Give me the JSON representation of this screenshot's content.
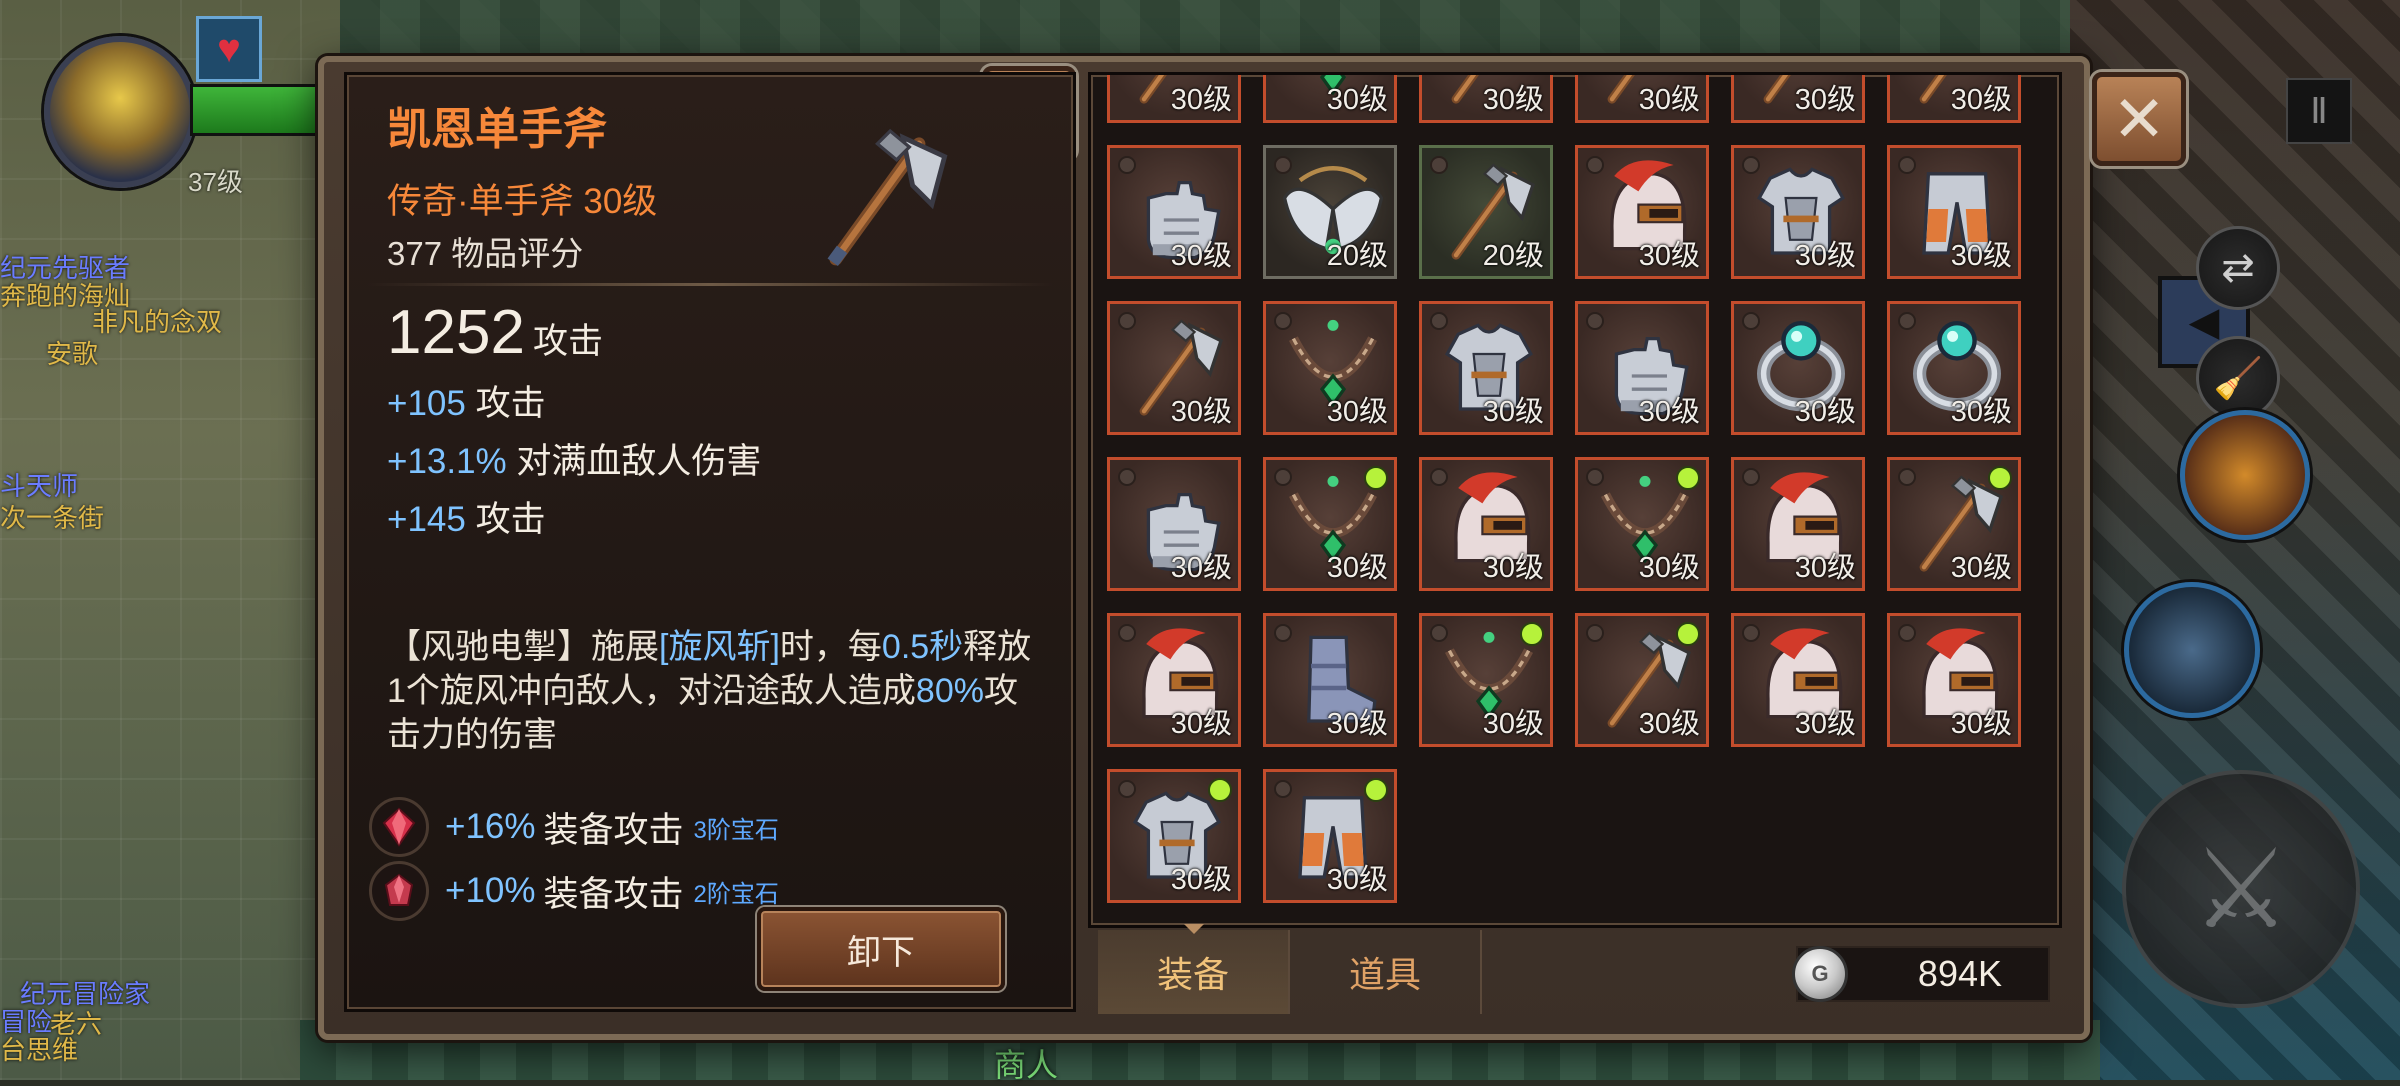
{
  "hud": {
    "level": "37级",
    "chat_names": [
      {
        "text": "纪元先驱者",
        "color": "#6a7cff"
      },
      {
        "text": "奔跑的海灿",
        "color": "#e0b848"
      },
      {
        "text": "非凡的念双",
        "color": "#e0b848"
      },
      {
        "text": "安歌",
        "color": "#e0b848"
      },
      {
        "text": "斗天师",
        "color": "#6a7cff"
      },
      {
        "text": "次一条街",
        "color": "#e0b848"
      },
      {
        "text": "纪元冒险家",
        "color": "#6a7cff"
      },
      {
        "text": "老六",
        "color": "#e0b848"
      },
      {
        "text": "冒险",
        "color": "#6a7cff"
      },
      {
        "text": "台思维",
        "color": "#e0b848"
      }
    ],
    "npc_label": "商人",
    "pause_icon": "Ⅱ",
    "collapse_icon": "◀"
  },
  "item_detail": {
    "name": "凯恩单手斧",
    "subtitle": "传奇·单手斧 30级",
    "score": "377 物品评分",
    "main_attack_value": "1252",
    "main_attack_label": "攻击",
    "stats": [
      {
        "value": "+105",
        "label": "攻击"
      },
      {
        "value": "+13.1%",
        "label": "对满血敌人伤害"
      },
      {
        "value": "+145",
        "label": "攻击"
      }
    ],
    "skill": {
      "part1": "【风驰电掣】施展",
      "skill_name": "[旋风斩]",
      "part2": "时，每",
      "interval": "0.5秒",
      "part3": "释放1个旋风冲向敌人，对沿途敌人造成",
      "percent": "80%",
      "part4": "攻击力的伤害"
    },
    "gems": [
      {
        "value": "+16%",
        "label": "装备攻击",
        "tier": "3阶宝石"
      },
      {
        "value": "+10%",
        "label": "装备攻击",
        "tier": "2阶宝石"
      }
    ],
    "unequip_label": "卸下"
  },
  "inventory": {
    "items": [
      {
        "type": "axe",
        "level": "30级",
        "rarity": "epic",
        "new": false
      },
      {
        "type": "necklace",
        "level": "30级",
        "rarity": "epic",
        "new": false
      },
      {
        "type": "axe",
        "level": "30级",
        "rarity": "epic",
        "new": false
      },
      {
        "type": "axe",
        "level": "30级",
        "rarity": "epic",
        "new": false
      },
      {
        "type": "axe",
        "level": "30级",
        "rarity": "epic",
        "new": false
      },
      {
        "type": "axe",
        "level": "30级",
        "rarity": "epic",
        "new": false
      },
      {
        "type": "gauntlet",
        "level": "30级",
        "rarity": "epic",
        "new": false
      },
      {
        "type": "wings",
        "level": "20级",
        "rarity": "rare",
        "new": false
      },
      {
        "type": "axe",
        "level": "20级",
        "rarity": "uncommon",
        "new": false
      },
      {
        "type": "helmet",
        "level": "30级",
        "rarity": "epic",
        "new": false
      },
      {
        "type": "armor",
        "level": "30级",
        "rarity": "epic",
        "new": false
      },
      {
        "type": "pants",
        "level": "30级",
        "rarity": "epic",
        "new": false
      },
      {
        "type": "axe",
        "level": "30级",
        "rarity": "epic",
        "new": false
      },
      {
        "type": "necklace",
        "level": "30级",
        "rarity": "epic",
        "new": false
      },
      {
        "type": "armor",
        "level": "30级",
        "rarity": "epic",
        "new": false
      },
      {
        "type": "gauntlet",
        "level": "30级",
        "rarity": "epic",
        "new": false
      },
      {
        "type": "ring",
        "level": "30级",
        "rarity": "epic",
        "new": false
      },
      {
        "type": "ring",
        "level": "30级",
        "rarity": "epic",
        "new": false
      },
      {
        "type": "gauntlet",
        "level": "30级",
        "rarity": "epic",
        "new": false
      },
      {
        "type": "necklace",
        "level": "30级",
        "rarity": "epic",
        "new": true
      },
      {
        "type": "helmet",
        "level": "30级",
        "rarity": "epic",
        "new": false
      },
      {
        "type": "necklace",
        "level": "30级",
        "rarity": "epic",
        "new": true
      },
      {
        "type": "helmet",
        "level": "30级",
        "rarity": "epic",
        "new": false
      },
      {
        "type": "axe",
        "level": "30级",
        "rarity": "epic",
        "new": true
      },
      {
        "type": "helmet",
        "level": "30级",
        "rarity": "epic",
        "new": false
      },
      {
        "type": "boots",
        "level": "30级",
        "rarity": "epic",
        "new": false
      },
      {
        "type": "necklace",
        "level": "30级",
        "rarity": "epic",
        "new": true
      },
      {
        "type": "axe",
        "level": "30级",
        "rarity": "epic",
        "new": true
      },
      {
        "type": "helmet",
        "level": "30级",
        "rarity": "epic",
        "new": false
      },
      {
        "type": "helmet",
        "level": "30级",
        "rarity": "epic",
        "new": false
      },
      {
        "type": "armor",
        "level": "30级",
        "rarity": "epic",
        "new": true
      },
      {
        "type": "pants",
        "level": "30级",
        "rarity": "epic",
        "new": true
      }
    ]
  },
  "tabs": [
    {
      "label": "装备",
      "active": true
    },
    {
      "label": "道具",
      "active": false
    }
  ],
  "currency": {
    "icon": "coin-icon",
    "amount": "894K"
  },
  "colors": {
    "legendary_orange": "#f7883a",
    "stat_blue": "#7fc3ff",
    "epic_border": "#c34d2c"
  }
}
